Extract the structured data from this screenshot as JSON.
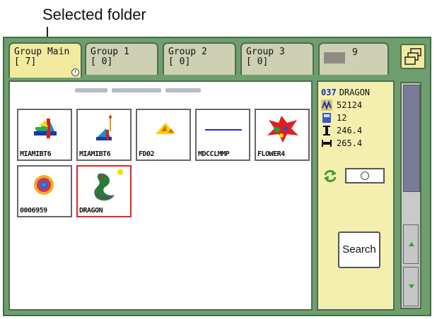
{
  "callout": {
    "label": "Selected folder"
  },
  "tabs": [
    {
      "line1": "Group Main",
      "line2": "[ 7]",
      "active": true
    },
    {
      "line1": "Group 1",
      "line2": "[ 0]",
      "active": false
    },
    {
      "line1": "Group 2",
      "line2": "[ 0]",
      "active": false
    },
    {
      "line1": "Group 3",
      "line2": "[ 0]",
      "active": false
    },
    {
      "line1": "9",
      "line2": "",
      "active": false
    }
  ],
  "designs": [
    {
      "name": "MIAMIBT6"
    },
    {
      "name": "MIAMIBT6"
    },
    {
      "name": "FD02"
    },
    {
      "name": "MDCCLMMP"
    },
    {
      "name": "FLOWER4"
    },
    {
      "name": "0006959"
    },
    {
      "name": "DRAGON",
      "selected": true
    }
  ],
  "info": {
    "number": "037",
    "design_name": "DRAGON",
    "stitches": "52124",
    "colors": "12",
    "height": "246.4",
    "width": "265.4"
  },
  "buttons": {
    "search_label": "Search"
  },
  "colors": {
    "screen_bg": "#6e9e6e",
    "active_tab": "#f1ea9f",
    "inactive_tab": "#cdd0b3",
    "selected_border": "#e02828",
    "info_bg": "#f4efaf"
  },
  "icons": [
    "clock-icon",
    "folder-stack-icon",
    "stitch-count-icon",
    "color-count-icon",
    "height-icon",
    "width-icon",
    "rotate-icon",
    "scroll-up-icon",
    "scroll-down-icon"
  ]
}
